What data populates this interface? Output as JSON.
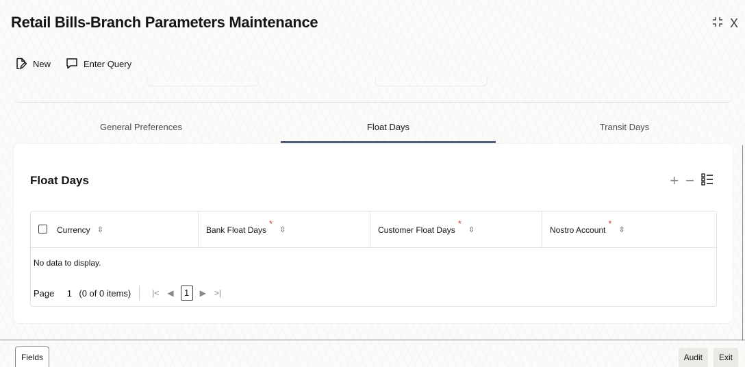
{
  "window": {
    "title": "Retail Bills-Branch Parameters Maintenance",
    "maximize_glyph": "⤡",
    "close_glyph": "X"
  },
  "toolbar": {
    "new_label": "New",
    "enter_query_label": "Enter Query"
  },
  "tabs": [
    {
      "label": "General Preferences",
      "active": false
    },
    {
      "label": "Float Days",
      "active": true
    },
    {
      "label": "Transit Days",
      "active": false
    }
  ],
  "section": {
    "title": "Float Days",
    "add_glyph": "+",
    "remove_glyph": "−",
    "columns_glyph": "☰"
  },
  "table": {
    "columns": [
      {
        "label": "Currency",
        "required": false
      },
      {
        "label": "Bank Float Days",
        "required": true
      },
      {
        "label": "Customer Float Days",
        "required": true
      },
      {
        "label": "Nostro Account",
        "required": true
      }
    ],
    "sort_glyph": "⇳",
    "required_glyph": "*",
    "empty_message": "No data to display."
  },
  "pager": {
    "page_label": "Page",
    "page_value": "1",
    "info": "(0 of 0 items)",
    "first_glyph": "|<",
    "prev_glyph": "◀",
    "current_page": "1",
    "next_glyph": "▶",
    "last_glyph": ">|"
  },
  "footer": {
    "fields_label": "Fields",
    "audit_label": "Audit",
    "exit_label": "Exit"
  },
  "colors": {
    "accent": "#4e5d7a",
    "required": "#c74634"
  },
  "icons": {
    "new": "new-document-icon",
    "enter_query": "query-icon"
  }
}
